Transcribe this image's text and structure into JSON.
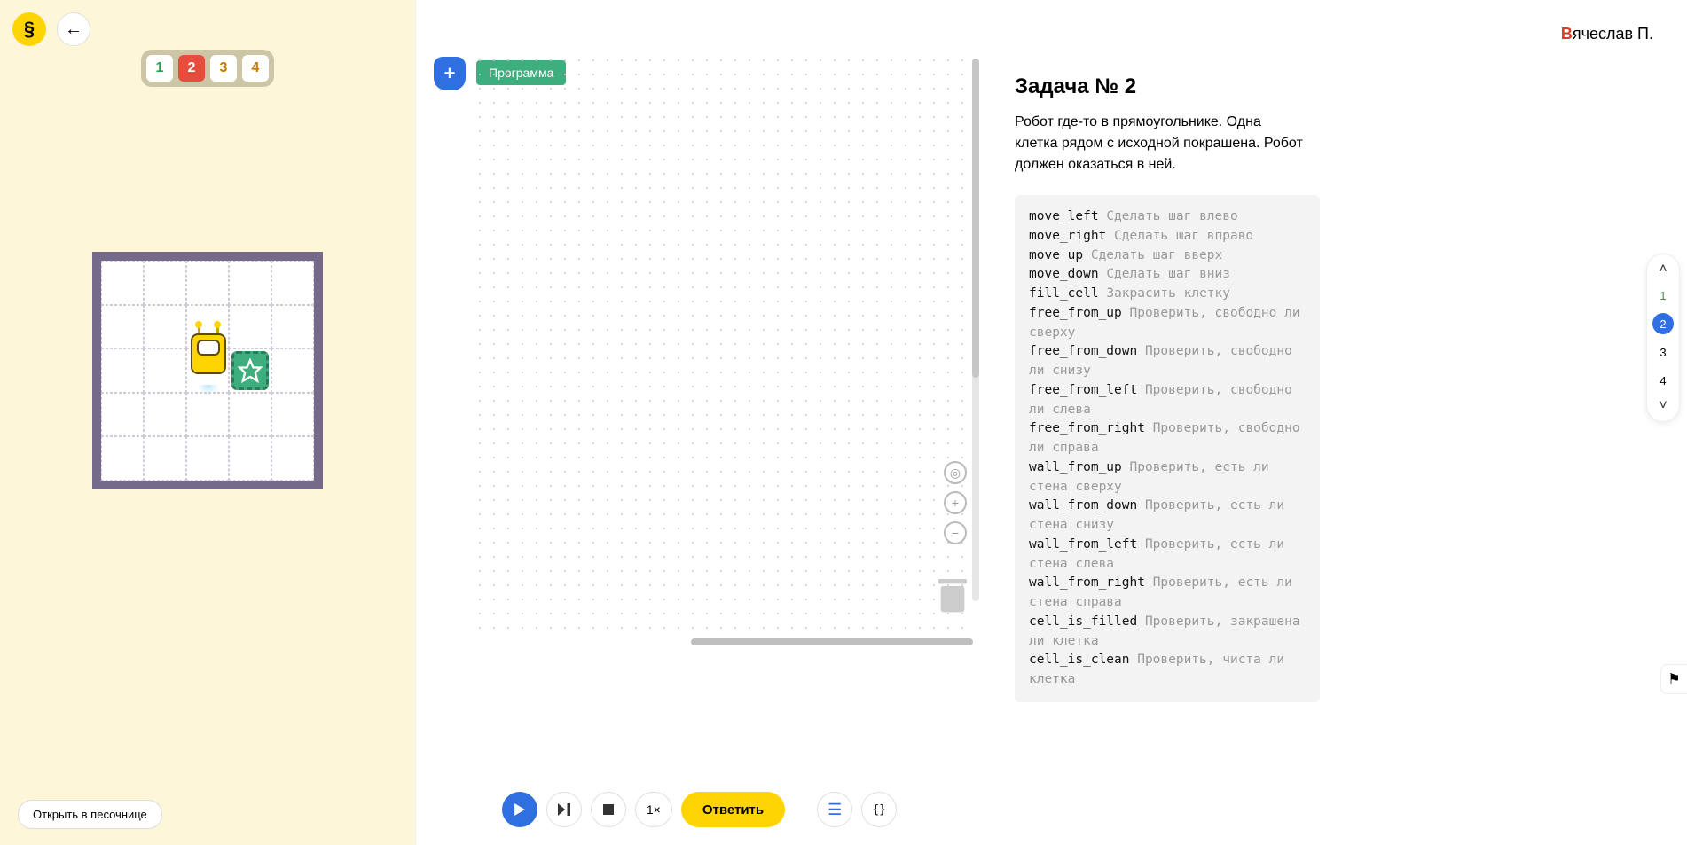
{
  "header": {
    "logo_glyph": "§",
    "username_first_char": "В",
    "username_rest": "ячеслав П."
  },
  "steps": {
    "items": [
      "1",
      "2",
      "3",
      "4"
    ],
    "done_index": 0,
    "active_index": 1
  },
  "sandbox_link": "Открыть в песочнице",
  "workspace": {
    "add_label": "+",
    "program_block": "Программа"
  },
  "controls": {
    "speed": "1×",
    "answer": "Ответить"
  },
  "task": {
    "title": "Задача № 2",
    "description": "Робот где-то в прямоугольнике. Одна клетка рядом с исходной покрашена. Робот должен оказаться в ней."
  },
  "commands": [
    {
      "name": "move_left",
      "hint": "Сделать шаг влево"
    },
    {
      "name": "move_right",
      "hint": "Сделать шаг вправо"
    },
    {
      "name": "move_up",
      "hint": "Сделать шаг вверх"
    },
    {
      "name": "move_down",
      "hint": "Сделать шаг вниз"
    },
    {
      "name": "fill_cell",
      "hint": "Закрасить клетку"
    },
    {
      "name": "free_from_up",
      "hint": "Проверить, свободно ли сверху"
    },
    {
      "name": "free_from_down",
      "hint": "Проверить, свободно ли снизу"
    },
    {
      "name": "free_from_left",
      "hint": "Проверить, свободно ли слева"
    },
    {
      "name": "free_from_right",
      "hint": "Проверить, свободно ли справа"
    },
    {
      "name": "wall_from_up",
      "hint": "Проверить, есть ли стена сверху"
    },
    {
      "name": "wall_from_down",
      "hint": "Проверить, есть ли стена снизу"
    },
    {
      "name": "wall_from_left",
      "hint": "Проверить, есть ли стена слева"
    },
    {
      "name": "wall_from_right",
      "hint": "Проверить, есть ли стена справа"
    },
    {
      "name": "cell_is_filled",
      "hint": "Проверить, закрашена ли клетка"
    },
    {
      "name": "cell_is_clean",
      "hint": "Проверить, чиста ли клетка"
    }
  ],
  "side_nav": {
    "items": [
      "1",
      "2",
      "3",
      "4"
    ],
    "done_index": 0,
    "active_index": 1
  }
}
